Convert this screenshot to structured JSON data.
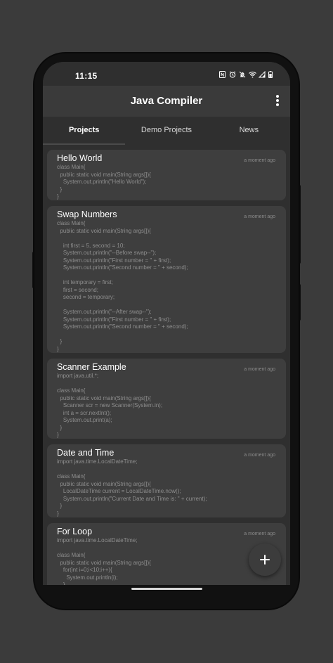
{
  "status_bar": {
    "time": "11:15",
    "icons": [
      "nfc-icon",
      "alarm-icon",
      "mute-icon",
      "wifi-icon",
      "signal-icon",
      "battery-icon"
    ]
  },
  "app_bar": {
    "title": "Java Compiler",
    "menu_icon": "more-vertical-icon"
  },
  "tabs": [
    {
      "label": "Projects",
      "active": true
    },
    {
      "label": "Demo Projects",
      "active": false
    },
    {
      "label": "News",
      "active": false
    }
  ],
  "projects": [
    {
      "title": "Hello World",
      "time": "a moment ago",
      "code": "class Main{\n  public static void main(String args[]){\n    System.out.println(\"Hello World\");\n  }\n}"
    },
    {
      "title": "Swap Numbers",
      "time": "a moment ago",
      "code": "class Main{\n  public static void main(String args[]){\n\n    int first = 5, second = 10;\n    System.out.println(\"--Before swap--\");\n    System.out.println(\"First number = \" + first);\n    System.out.println(\"Second number = \" + second);\n\n    int temporary = first;\n    first = second;\n    second = temporary;\n\n    System.out.println(\"--After swap--\");\n    System.out.println(\"First number = \" + first);\n    System.out.println(\"Second number = \" + second);\n\n  }\n}"
    },
    {
      "title": "Scanner Example",
      "time": "a moment ago",
      "code": "import java.util.*;\n\nclass Main{\n  public static void main(String args[]){\n    Scanner scr = new Scanner(System.in);\n    int a = scr.nextInt();\n    System.out.print(a);\n  }\n}"
    },
    {
      "title": "Date and Time",
      "time": "a moment ago",
      "code": "import java.time.LocalDateTime;\n\nclass Main{\n  public static void main(String args[]){\n    LocalDateTime current = LocalDateTime.now();\n    System.out.println(\"Current Date and Time is: \" + current);\n  }\n}"
    },
    {
      "title": "For Loop",
      "time": "a moment ago",
      "code": "import java.time.LocalDateTime;\n\nclass Main{\n  public static void main(String args[]){\n    for(int i=0;i<10;i++){\n      System.out.println(i);\n    }"
    }
  ],
  "fab": {
    "icon": "plus-icon"
  },
  "colors": {
    "background": "#3b3b3b",
    "screen": "#2f2f2f",
    "app_bar": "#3a3a3a",
    "card": "#3e3e3e",
    "code_text": "#8e8e8e"
  }
}
